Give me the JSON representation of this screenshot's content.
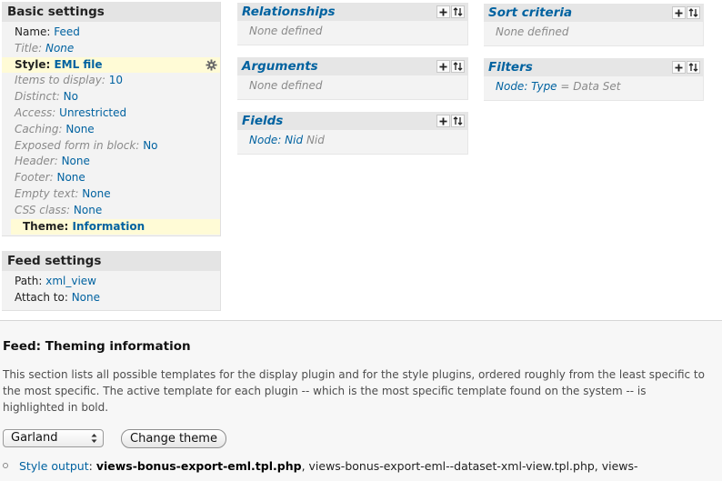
{
  "basic": {
    "title": "Basic settings",
    "rows": [
      {
        "label": "Name:",
        "value": "Feed"
      },
      {
        "label": "Title:",
        "value": "None"
      },
      {
        "label": "Style:",
        "value": "EML file"
      },
      {
        "label": "Items to display:",
        "value": "10"
      },
      {
        "label": "Distinct:",
        "value": "No"
      },
      {
        "label": "Access:",
        "value": "Unrestricted"
      },
      {
        "label": "Caching:",
        "value": "None"
      },
      {
        "label": "Exposed form in block:",
        "value": "No"
      },
      {
        "label": "Header:",
        "value": "None"
      },
      {
        "label": "Footer:",
        "value": "None"
      },
      {
        "label": "Empty text:",
        "value": "None"
      },
      {
        "label": "CSS class:",
        "value": "None"
      },
      {
        "label": "Theme:",
        "value": "Information"
      }
    ]
  },
  "feed": {
    "title": "Feed settings",
    "rows": [
      {
        "label": "Path:",
        "value": "xml_view"
      },
      {
        "label": "Attach to:",
        "value": "None"
      }
    ]
  },
  "blocks": {
    "relationships": {
      "title": "Relationships",
      "body": "None defined"
    },
    "arguments": {
      "title": "Arguments",
      "body": "None defined"
    },
    "fields": {
      "title": "Fields",
      "link": "Node: Nid",
      "rest": "Nid"
    },
    "sort": {
      "title": "Sort criteria",
      "body": "None defined"
    },
    "filters": {
      "title": "Filters",
      "link": "Node: Type",
      "rest": "= Data Set"
    }
  },
  "theming": {
    "title": "Feed: Theming information",
    "description": "This section lists all possible templates for the display plugin and for the style plugins, ordered roughly from the least specific to the most specific. The active template for each plugin -- which is the most specific template found on the system -- is highlighted in bold.",
    "theme_select": "Garland",
    "change_button": "Change theme",
    "output_label": "Style output",
    "output_sep": ":",
    "output_active": "views-bonus-export-eml.tpl.php",
    "output_rest": ", views-bonus-export-eml--dataset-xml-view.tpl.php, views-"
  },
  "colors": {
    "link": "#0062a0",
    "highlight": "#fffbd6"
  }
}
